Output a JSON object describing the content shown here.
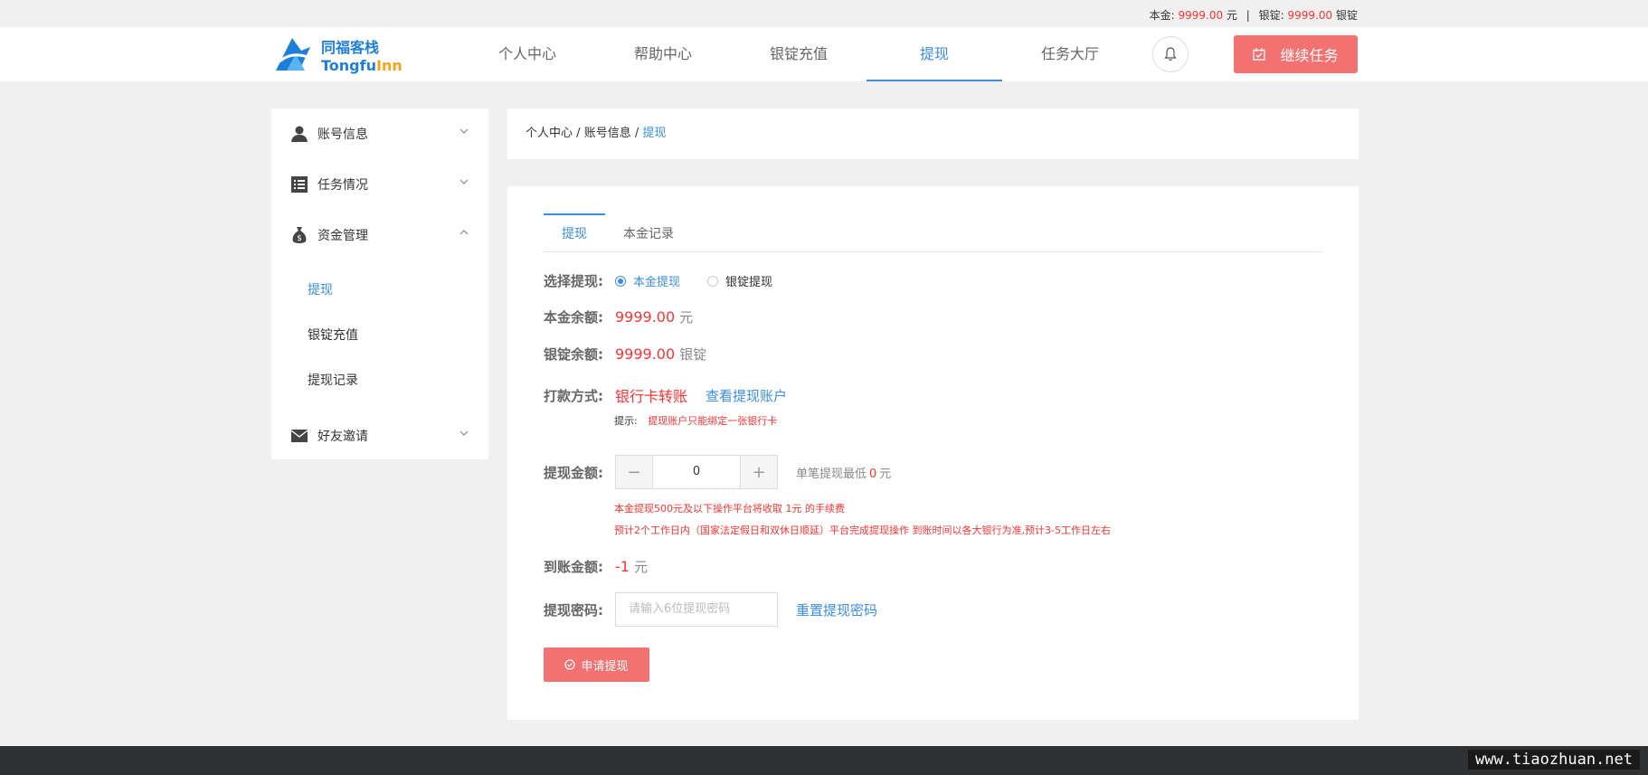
{
  "topbar": {
    "principal_label": "本金:",
    "principal_value": "9999.00",
    "principal_unit": "元",
    "separator": "|",
    "ingot_label": "银锭:",
    "ingot_value": "9999.00",
    "ingot_unit": "银锭"
  },
  "header": {
    "logo_cn": "同福客栈",
    "logo_en_1": "Tongfu",
    "logo_en_2": "Inn",
    "nav": [
      {
        "label": "个人中心",
        "active": false
      },
      {
        "label": "帮助中心",
        "active": false
      },
      {
        "label": "银锭充值",
        "active": false
      },
      {
        "label": "提现",
        "active": true
      },
      {
        "label": "任务大厅",
        "active": false
      }
    ],
    "bell_icon": "bell-icon",
    "continue_label": "继续任务"
  },
  "sidebar": {
    "items": [
      {
        "label": "账号信息",
        "icon": "user-icon",
        "expanded": false
      },
      {
        "label": "任务情况",
        "icon": "list-icon",
        "expanded": false
      },
      {
        "label": "资金管理",
        "icon": "money-bag-icon",
        "expanded": true
      },
      {
        "label": "好友邀请",
        "icon": "envelope-icon",
        "expanded": false
      }
    ],
    "submenu": [
      {
        "label": "提现",
        "active": true
      },
      {
        "label": "银锭充值",
        "active": false
      },
      {
        "label": "提现记录",
        "active": false
      }
    ]
  },
  "breadcrumb": {
    "items": [
      "个人中心",
      "账号信息"
    ],
    "separator": "/",
    "current": "提现"
  },
  "tabs": [
    {
      "label": "提现",
      "active": true
    },
    {
      "label": "本金记录",
      "active": false
    }
  ],
  "form": {
    "select_label": "选择提现:",
    "options": [
      {
        "label": "本金提现",
        "checked": true
      },
      {
        "label": "银锭提现",
        "checked": false
      }
    ],
    "principal_balance_label": "本金余额:",
    "principal_balance_value": "9999.00",
    "principal_balance_unit": "元",
    "ingot_balance_label": "银锭余额:",
    "ingot_balance_value": "9999.00",
    "ingot_balance_unit": "银锭",
    "payment_label": "打款方式:",
    "payment_value": "银行卡转账",
    "view_account_link": "查看提现账户",
    "hint_key": "提示:",
    "hint_value": "提现账户只能绑定一张银行卡",
    "amount_label": "提现金额:",
    "amount_value": "0",
    "minus": "−",
    "plus": "+",
    "min_note_prefix": "单笔提现最低",
    "min_note_value": "0",
    "min_note_unit": "元",
    "notice_1": "本金提现500元及以下操作平台将收取 1元 的手续费",
    "notice_2": "预计2个工作日内（国家法定假日和双休日顺延）平台完成提现操作 到账时间以各大银行为准,预计3-5工作日左右",
    "arrival_label": "到账金额:",
    "arrival_value": "-1",
    "arrival_unit": "元",
    "password_label": "提现密码:",
    "password_placeholder": "请输入6位提现密码",
    "reset_password_link": "重置提现密码",
    "apply_label": "申请提现"
  },
  "watermark": "www.tiaozhuan.net",
  "colors": {
    "accent": "#3a8ee6",
    "red": "#ff3333",
    "button": "#f27272",
    "footer": "#2f3133"
  }
}
